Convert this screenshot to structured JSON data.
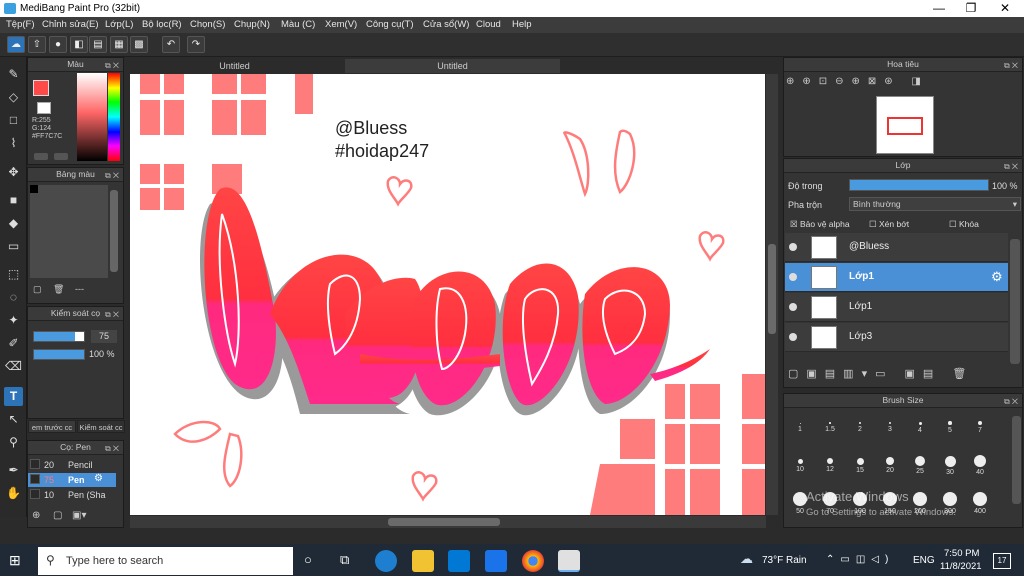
{
  "window": {
    "title": "MediBang Paint Pro (32bit)",
    "min": "—",
    "max": "❐",
    "close": "✕"
  },
  "menu": [
    "Tệp(F)",
    "Chỉnh sửa(E)",
    "Lớp(L)",
    "Bộ lọc(R)",
    "Chọn(S)",
    "Chụp(N)",
    "Màu (C)",
    "Xem(V)",
    "Công cụ(T)",
    "Cửa sổ(W)",
    "Cloud",
    "Help"
  ],
  "tabs": [
    "Untitled",
    "Untitled"
  ],
  "color_panel": {
    "title": "Màu",
    "r": "R:255",
    "g": "G:124",
    "hex": "#FF7C7C",
    "primary": "#FF4A4A"
  },
  "palette_panel": {
    "title": "Bảng màu",
    "dash": "---"
  },
  "control_panel": {
    "title": "Kiểm soát cọ",
    "size_value": "75",
    "opacity_value": "100 %",
    "size_fill": 0.82,
    "opacity_fill": 1.0
  },
  "sub_tabs": [
    "em trước cc",
    "Kiểm soát cc"
  ],
  "brush_panel": {
    "title": "Cọ: Pen",
    "items": [
      {
        "size": "20",
        "name": "Pencil"
      },
      {
        "size": "75",
        "name": "Pen"
      },
      {
        "size": "10",
        "name": "Pen (Sha"
      }
    ]
  },
  "canvas": {
    "line1": "@Bluess",
    "line2": "#hoidap247",
    "accent": "#FF7C7C"
  },
  "navigator": {
    "title": "Hoa tiêu"
  },
  "layer_panel": {
    "title": "Lớp",
    "opacity_label": "Độ trong",
    "opacity_value": "100 %",
    "blend_label": "Pha trộn",
    "blend_value": "Bình thường",
    "protect_alpha": "Bảo vệ alpha",
    "clipping": "Xén bớt",
    "lock": "Khóa",
    "layers": [
      "@Bluess",
      "Lớp1",
      "Lớp1",
      "Lớp3"
    ]
  },
  "brush_size": {
    "title": "Brush Size",
    "sizes": [
      "1",
      "1.5",
      "2",
      "3",
      "4",
      "5",
      "7",
      "10",
      "12",
      "15",
      "20",
      "25",
      "30",
      "40",
      "50",
      "70",
      "100",
      "150",
      "200",
      "300",
      "400"
    ]
  },
  "watermark": {
    "line1": "Activate Windows",
    "line2": "Go to Settings to activate Windows."
  },
  "taskbar": {
    "search_placeholder": "Type here to search",
    "weather": "73°F  Rain",
    "lang": "ENG",
    "time": "7:50 PM",
    "date": "11/8/2021",
    "notif": "17"
  }
}
